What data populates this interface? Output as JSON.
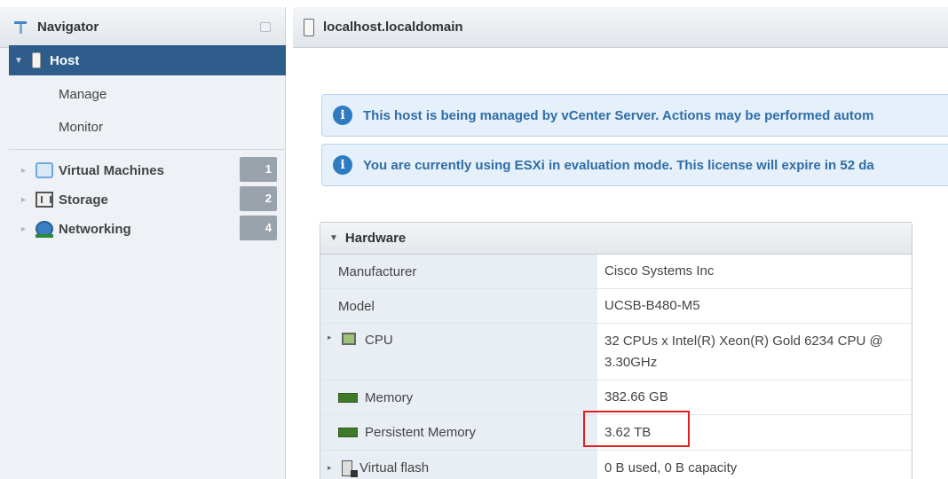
{
  "navigator": {
    "title": "Navigator",
    "host": {
      "label": "Host",
      "children": [
        "Manage",
        "Monitor"
      ]
    },
    "items": [
      {
        "label": "Virtual Machines",
        "count": "1"
      },
      {
        "label": "Storage",
        "count": "2"
      },
      {
        "label": "Networking",
        "count": "4"
      }
    ]
  },
  "main": {
    "title": "localhost.localdomain",
    "banners": [
      "This host is being managed by vCenter Server. Actions may be performed autom",
      "You are currently using ESXi in evaluation mode. This license will expire in 52 da"
    ],
    "hardware": {
      "title": "Hardware",
      "rows": [
        {
          "label": "Manufacturer",
          "value": "Cisco Systems Inc"
        },
        {
          "label": "Model",
          "value": "UCSB-B480-M5"
        },
        {
          "label": "CPU",
          "value": "32 CPUs x Intel(R) Xeon(R) Gold 6234 CPU @ 3.30GHz"
        },
        {
          "label": "Memory",
          "value": "382.66 GB"
        },
        {
          "label": "Persistent Memory",
          "value": "3.62 TB"
        },
        {
          "label": "Virtual flash",
          "value": "0 B used, 0 B capacity"
        }
      ]
    }
  },
  "colors": {
    "selected_nav": "#2e5d8b",
    "banner_bg": "#e5f0fa",
    "highlight_box": "#e02020"
  }
}
